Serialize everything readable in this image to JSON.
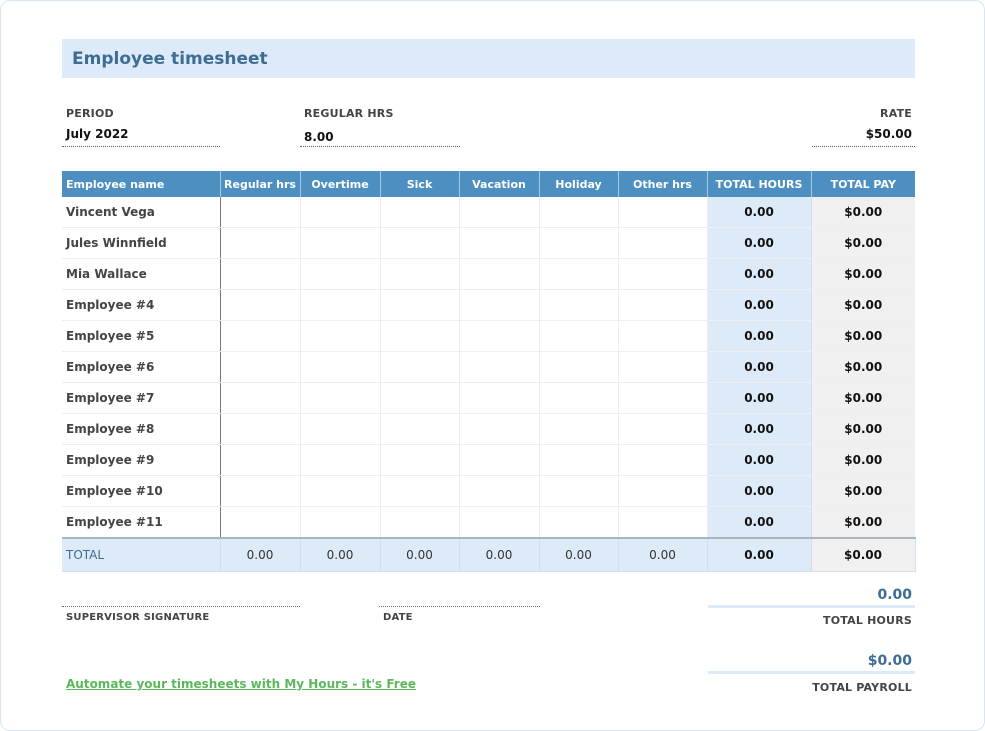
{
  "title": "Employee timesheet",
  "meta": {
    "period_label": "PERIOD",
    "period_value": "July 2022",
    "regular_label": "REGULAR HRS",
    "regular_value": "8.00",
    "rate_label": "RATE",
    "rate_value": "$50.00"
  },
  "table": {
    "headers": [
      "Employee name",
      "Regular hrs",
      "Overtime",
      "Sick",
      "Vacation",
      "Holiday",
      "Other hrs",
      "TOTAL HOURS",
      "TOTAL PAY"
    ],
    "rows": [
      {
        "name": "Vincent Vega",
        "total_hours": "0.00",
        "total_pay": "$0.00"
      },
      {
        "name": "Jules Winnfield",
        "total_hours": "0.00",
        "total_pay": "$0.00"
      },
      {
        "name": "Mia Wallace",
        "total_hours": "0.00",
        "total_pay": "$0.00"
      },
      {
        "name": "Employee #4",
        "total_hours": "0.00",
        "total_pay": "$0.00"
      },
      {
        "name": "Employee #5",
        "total_hours": "0.00",
        "total_pay": "$0.00"
      },
      {
        "name": "Employee #6",
        "total_hours": "0.00",
        "total_pay": "$0.00"
      },
      {
        "name": "Employee #7",
        "total_hours": "0.00",
        "total_pay": "$0.00"
      },
      {
        "name": "Employee #8",
        "total_hours": "0.00",
        "total_pay": "$0.00"
      },
      {
        "name": "Employee #9",
        "total_hours": "0.00",
        "total_pay": "$0.00"
      },
      {
        "name": "Employee #10",
        "total_hours": "0.00",
        "total_pay": "$0.00"
      },
      {
        "name": "Employee #11",
        "total_hours": "0.00",
        "total_pay": "$0.00"
      }
    ],
    "totals": {
      "label": "TOTAL",
      "values": [
        "0.00",
        "0.00",
        "0.00",
        "0.00",
        "0.00",
        "0.00"
      ],
      "total_hours": "0.00",
      "total_pay": "$0.00"
    }
  },
  "footer": {
    "supervisor_label": "SUPERVISOR SIGNATURE",
    "date_label": "DATE",
    "total_hours_value": "0.00",
    "total_hours_label": "TOTAL HOURS",
    "total_payroll_value": "$0.00",
    "total_payroll_label": "TOTAL PAYROLL",
    "promo_link": "Automate your timesheets with My Hours - it's Free"
  },
  "colors": {
    "header_blue": "#4e8fc2",
    "light_blue": "#ddeaf7",
    "title_text": "#3d6d94",
    "link_green": "#5cb85c"
  }
}
